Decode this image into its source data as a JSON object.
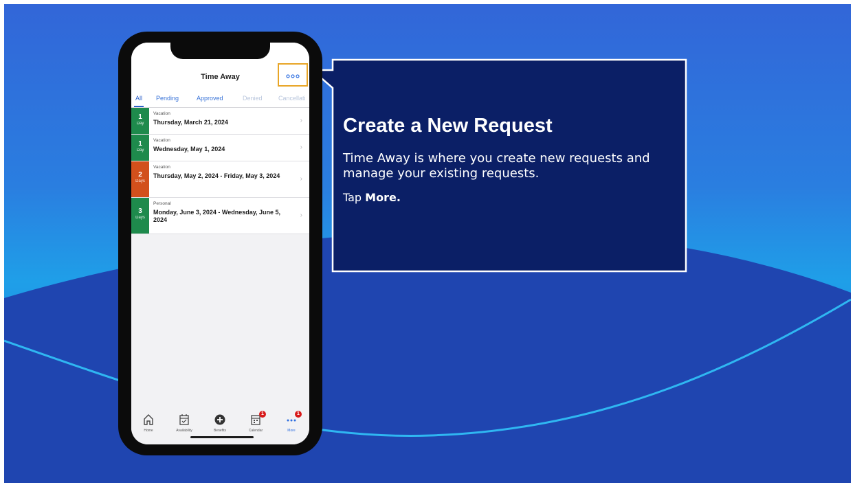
{
  "colors": {
    "vacation_badge": "#1e8a4c",
    "multi_day_badge": "#d2501c",
    "callout_bg": "#0b1f66",
    "highlight_border": "#e8a526",
    "link_blue": "#2f6fe0"
  },
  "app": {
    "title": "Time Away",
    "more_icon": "more-dots-icon",
    "tabs": [
      "All",
      "Pending",
      "Approved",
      "Denied",
      "Cancellati"
    ],
    "active_tab": "All"
  },
  "requests": [
    {
      "count": "1",
      "unit": "Day",
      "type": "Vacation",
      "date": "Thursday, March 21, 2024",
      "color": "#1e8a4c"
    },
    {
      "count": "1",
      "unit": "Day",
      "type": "Vacation",
      "date": "Wednesday, May 1, 2024",
      "color": "#1e8a4c"
    },
    {
      "count": "2",
      "unit": "Days",
      "type": "Vacation",
      "date": "Thursday, May 2, 2024 - Friday, May 3, 2024",
      "color": "#d2501c"
    },
    {
      "count": "3",
      "unit": "Days",
      "type": "Personal",
      "date": "Monday, June 3, 2024 - Wednesday, June 5, 2024",
      "color": "#1e8a4c"
    }
  ],
  "tabbar": [
    {
      "label": "Home",
      "icon": "home-icon"
    },
    {
      "label": "Availability",
      "icon": "availability-icon"
    },
    {
      "label": "Benefits",
      "icon": "plus-circle-icon"
    },
    {
      "label": "Calendar",
      "icon": "calendar-icon",
      "badge": "1"
    },
    {
      "label": "More",
      "icon": "more-dots-icon",
      "badge": "1"
    }
  ],
  "callout": {
    "title": "Create a New Request",
    "body": "Time Away is where you create new requests and manage your existing requests.",
    "cta_prefix": "Tap ",
    "cta_bold": "More."
  }
}
